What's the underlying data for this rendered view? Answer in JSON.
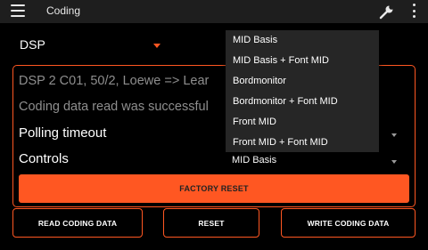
{
  "app_bar": {
    "title": "Coding",
    "menu_icon": "hamburger-menu-icon",
    "wrench_icon": "wrench-icon",
    "overflow_icon": "more-vert-icon"
  },
  "device_select": {
    "value": "DSP"
  },
  "panel": {
    "info_line_1": "DSP 2 C01, 50/2, Loewe => Lear",
    "info_line_2": "Coding data read was successful",
    "settings": [
      {
        "label": "Polling timeout",
        "value": ""
      },
      {
        "label": "Controls",
        "value": "MID Basis"
      }
    ],
    "factory_reset_label": "FACTORY RESET"
  },
  "bottom_buttons": {
    "read_label": "READ CODING DATA",
    "reset_label": "RESET",
    "write_label": "WRITE CODING DATA"
  },
  "dropdown": {
    "options": [
      "MID Basis",
      "MID Basis + Font MID",
      "Bordmonitor",
      "Bordmonitor + Font MID",
      "Front MID",
      "Front MID + Font MID"
    ]
  },
  "colors": {
    "accent": "#ff5722",
    "background": "#000000",
    "app_bar": "#1e1e1e",
    "popup": "#262626",
    "muted_text": "#8e8e8e"
  }
}
